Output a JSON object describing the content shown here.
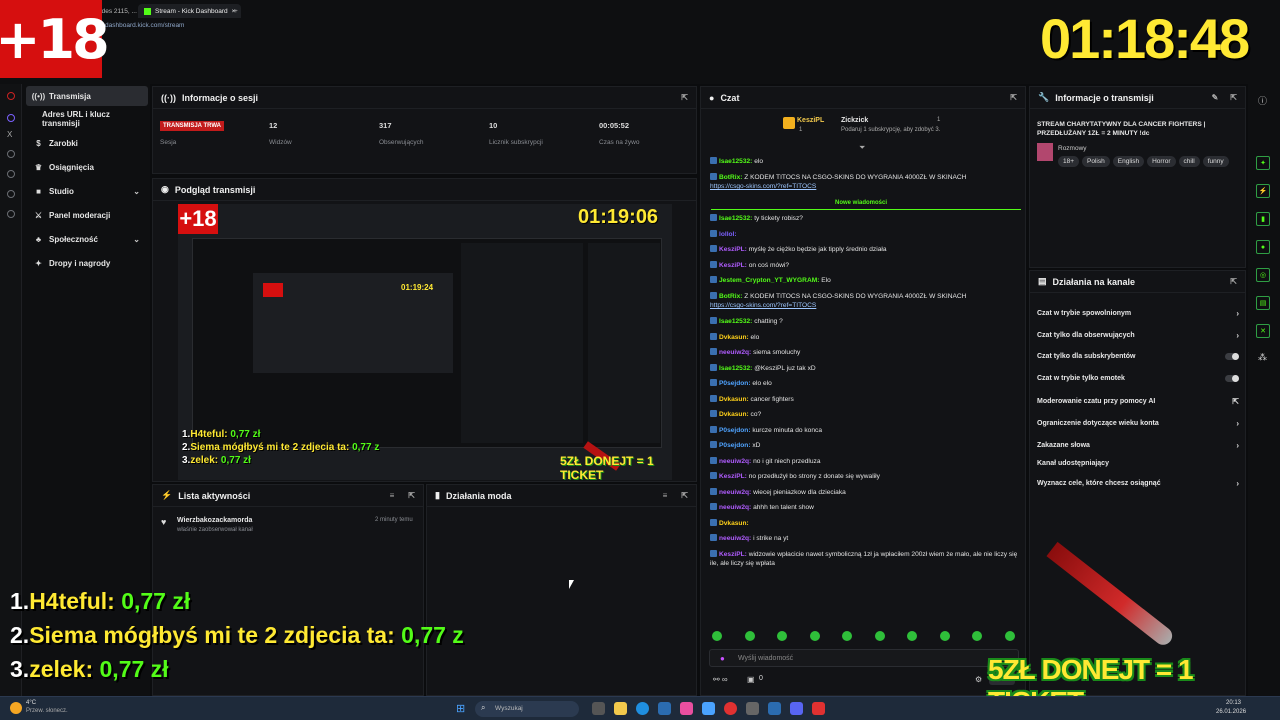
{
  "browser": {
    "tabs": [
      {
        "label": "odes 2115, ..."
      },
      {
        "label": "Stream - Kick Dashboard"
      }
    ],
    "new_tab": "+",
    "url": "dashboard.kick.com/stream"
  },
  "overlay": {
    "age_badge": "+18",
    "timer": "01:18:48",
    "leaderboard": [
      {
        "rank": "1.",
        "name": "H4teful:",
        "value": "0,77 zł"
      },
      {
        "rank": "2.",
        "name": "Siema mógłbyś mi te 2 zdjecia ta:",
        "value": "0,77 z"
      },
      {
        "rank": "3.",
        "name": "zelek:",
        "value": "0,77 zł"
      }
    ],
    "donate_text": "5ZŁ DONEJT = 1 TICKET"
  },
  "sidebar": {
    "items": [
      {
        "label": "Transmisja",
        "icon": "broadcast-icon"
      },
      {
        "label": "Adres URL i klucz transmisji",
        "icon": ""
      },
      {
        "label": "Zarobki",
        "icon": "money-icon"
      },
      {
        "label": "Osiągnięcia",
        "icon": "trophy-icon"
      },
      {
        "label": "Studio",
        "icon": "studio-icon"
      },
      {
        "label": "Panel moderacji",
        "icon": "sword-icon"
      },
      {
        "label": "Społeczność",
        "icon": "community-icon"
      },
      {
        "label": "Dropy i nagrody",
        "icon": "gift-icon"
      }
    ]
  },
  "session": {
    "title": "Informacje o sesji",
    "live_badge": "TRANSMISJA TRWA",
    "session_label": "Sesja",
    "stats": [
      {
        "value": "12",
        "label": "Widzów"
      },
      {
        "value": "317",
        "label": "Obserwujących"
      },
      {
        "value": "10",
        "label": "Licznik subskrypcji"
      },
      {
        "value": "00:05:52",
        "label": "Czas na żywo"
      }
    ]
  },
  "preview": {
    "title": "Podgląd transmisji",
    "timer": "01:19:06",
    "inner_timer": "01:19:24",
    "donate_text": "5ZŁ DONEJT = 1 TICKET",
    "leaderboard": [
      {
        "rank": "1.",
        "name": "H4teful:",
        "value": "0,77 zł"
      },
      {
        "rank": "2.",
        "name": "Siema mógłbyś mi te 2 zdjecia ta:",
        "value": "0,77 z"
      },
      {
        "rank": "3.",
        "name": "zelek:",
        "value": "0,77 zł"
      }
    ]
  },
  "activity": {
    "title": "Lista aktywności",
    "entries": [
      {
        "user": "Wierzbakozackamorda",
        "text": "właśnie zaobserwował kanał",
        "time": "2 minuty temu"
      }
    ]
  },
  "mod_actions": {
    "title": "Działania moda"
  },
  "chat": {
    "title": "Czat",
    "pinned": {
      "user1": "KesziPL",
      "count1": "1",
      "user2": "Zickzick",
      "count2": "1",
      "text": "Podaruj 1 subskrypcję, aby zdobyć 3."
    },
    "new_messages": "Nowe wiadomości",
    "messages": [
      {
        "user": "Isae12532:",
        "text": "elo",
        "color": "#53fc18"
      },
      {
        "user": "BotRix:",
        "text": "Z KODEM TITOCS NA CSGO-SKINS DO WYGRANIA 4000ZŁ W SKINACH",
        "color": "#53fc18",
        "link": "https://csgo-skins.com/?ref=TITOCS"
      },
      {
        "user": "Isae12532:",
        "text": "ty tickety robisz?",
        "color": "#53fc18"
      },
      {
        "user": "lollol:",
        "text": "",
        "color": "#7b61ff"
      },
      {
        "user": "KesziPL:",
        "text": "myślę że ciężko będzie jak tipply średnio działa",
        "color": "#b05cff"
      },
      {
        "user": "KesziPL:",
        "text": "on coś mówi?",
        "color": "#b05cff"
      },
      {
        "user": "Jestem_Crypton_YT_WYGRAM:",
        "text": "Elo",
        "color": "#53fc18"
      },
      {
        "user": "BotRix:",
        "text": "Z KODEM TITOCS NA CSGO-SKINS DO WYGRANIA 4000ZŁ W SKINACH",
        "color": "#53fc18",
        "link": "https://csgo-skins.com/?ref=TITOCS"
      },
      {
        "user": "Isae12532:",
        "text": "chatting ?",
        "color": "#53fc18"
      },
      {
        "user": "Dvkasun:",
        "text": "elo",
        "color": "#ffd11a"
      },
      {
        "user": "neeuiw2q:",
        "text": "siema smoluchy",
        "color": "#b05cff"
      },
      {
        "user": "Isae12532:",
        "text": "@KesziPL juz tak xD",
        "color": "#53fc18"
      },
      {
        "user": "P0sejdon:",
        "text": "elo elo",
        "color": "#4fa3ff"
      },
      {
        "user": "Dvkasun:",
        "text": "cancer fighters",
        "color": "#ffd11a"
      },
      {
        "user": "Dvkasun:",
        "text": "co?",
        "color": "#ffd11a"
      },
      {
        "user": "P0sejdon:",
        "text": "kurcze minuta do konca",
        "color": "#4fa3ff"
      },
      {
        "user": "P0sejdon:",
        "text": "xD",
        "color": "#4fa3ff"
      },
      {
        "user": "neeuiw2q:",
        "text": "no i git niech przedluza",
        "color": "#b05cff"
      },
      {
        "user": "KesziPL:",
        "text": "no przedłużył bo strony z donate się wywaliły",
        "color": "#b05cff"
      },
      {
        "user": "neeuiw2q:",
        "text": "wiecej pieniazkow dla dzieciaka",
        "color": "#b05cff"
      },
      {
        "user": "neeuiw2q:",
        "text": "ahhh ten talent show",
        "color": "#b05cff"
      },
      {
        "user": "Dvkasun:",
        "text": "",
        "color": "#ffd11a"
      },
      {
        "user": "neeuiw2q:",
        "text": "i strike na yt",
        "color": "#b05cff"
      },
      {
        "user": "KesziPL:",
        "text": "widzowie wpłacicie nawet symboliczną 1zł ja wpłaciłem 200zł wiem że mało, ale nie liczy się ile, ale liczy się wpłata",
        "color": "#b05cff"
      }
    ],
    "input_placeholder": "Wyślij wiadomość",
    "footer_count": "0"
  },
  "stream_info": {
    "title": "Informacje o transmisji",
    "stream_title": "STREAM CHARYTATYWNY DLA CANCER FIGHTERS | PRZEDŁUŻANY 1ZŁ = 2 MINUTY !dc",
    "category": "Rozmowy",
    "tags": [
      "18+",
      "Polish",
      "English",
      "Horror",
      "chill",
      "funny"
    ]
  },
  "channel_actions": {
    "title": "Działania na kanale",
    "items": [
      {
        "label": "Czat w trybie spowolnionym",
        "control": "arrow"
      },
      {
        "label": "Czat tylko dla obserwujących",
        "control": "arrow"
      },
      {
        "label": "Czat tylko dla subskrybentów",
        "control": "toggle"
      },
      {
        "label": "Czat w trybie tylko emotek",
        "control": "toggle"
      },
      {
        "label": "Moderowanie czatu przy pomocy AI",
        "control": "external"
      },
      {
        "label": "Ograniczenie dotyczące wieku konta",
        "control": "arrow"
      },
      {
        "label": "Zakazane słowa",
        "control": "arrow"
      },
      {
        "label": "Kanał udostępniający",
        "control": "none"
      },
      {
        "label": "Wyznacz cele, które chcesz osiągnąć",
        "control": "arrow"
      }
    ]
  },
  "taskbar": {
    "weather_temp": "4°C",
    "weather_text": "Przew. słonecz.",
    "search_placeholder": "Wyszukaj",
    "time": "20:13",
    "date": "26.01.2026"
  },
  "colors": {
    "kick_green": "#53fc18",
    "live_red": "#c21b1b",
    "overlay_yellow": "#ffe933"
  }
}
